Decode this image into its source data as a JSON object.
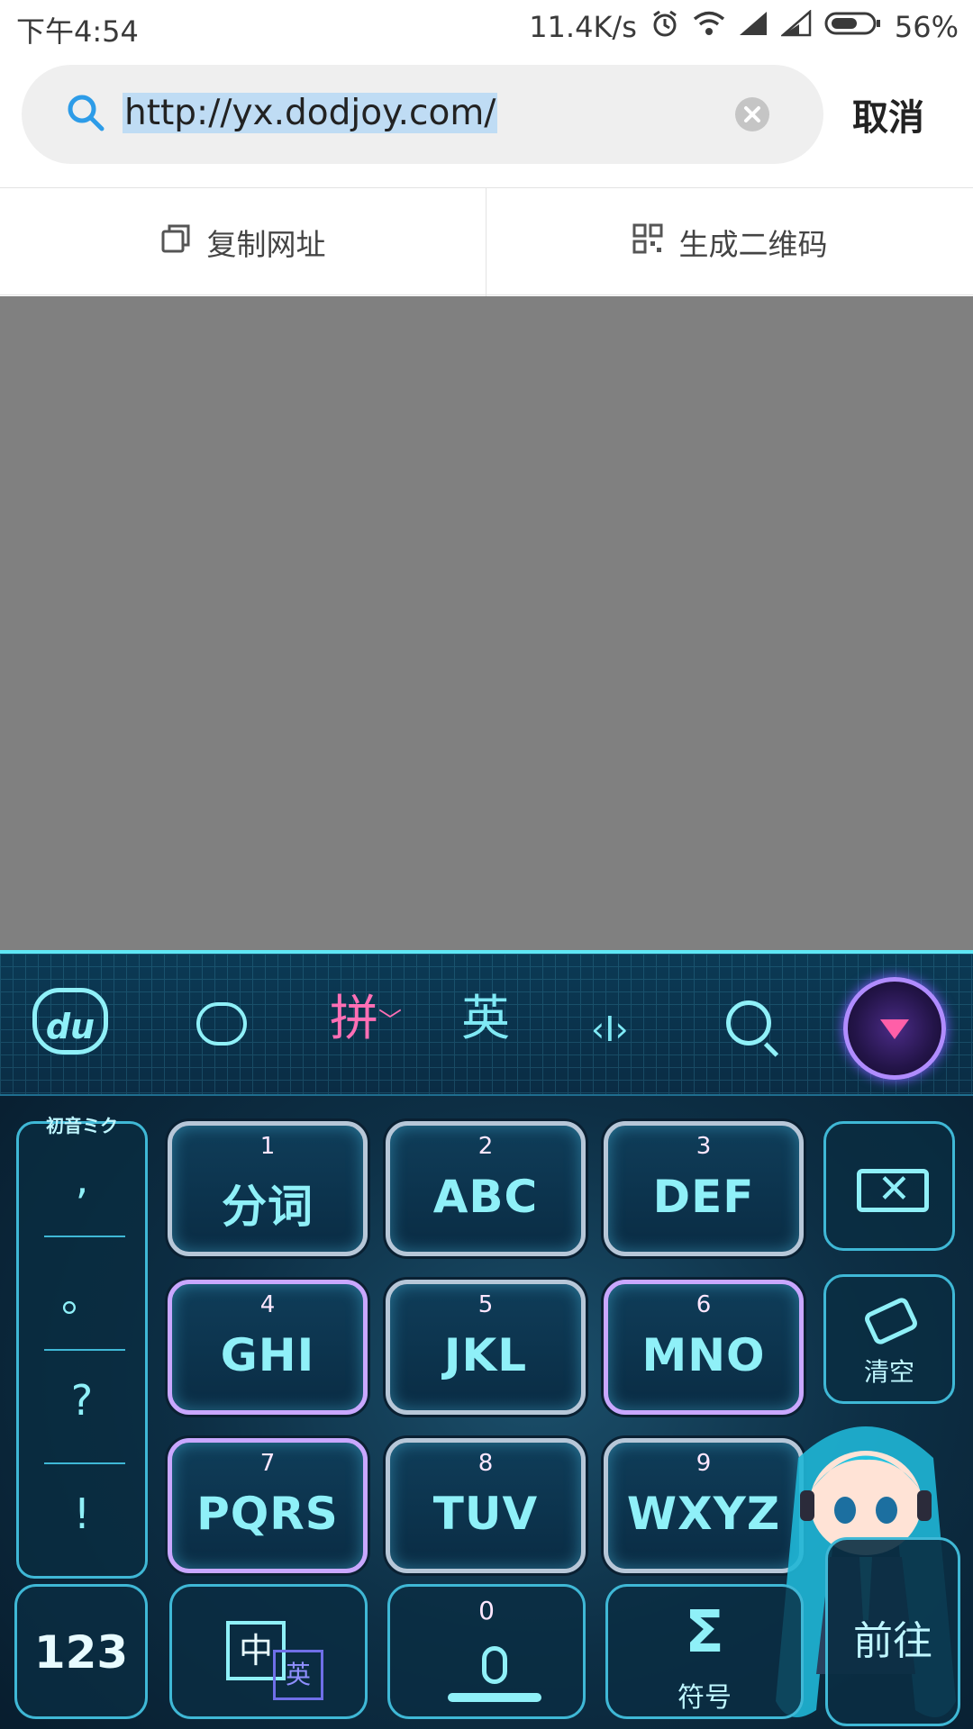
{
  "status_bar": {
    "time": "下午4:54",
    "speed": "11.4K/s",
    "battery": "56%"
  },
  "search": {
    "url": "http://yx.dodjoy.com/",
    "cancel_label": "取消"
  },
  "actions": {
    "copy_label": "复制网址",
    "qr_label": "生成二维码"
  },
  "keyboard": {
    "toolbar": {
      "logo": "du",
      "pinyin": "拼",
      "english": "英",
      "cursor": "‹I›"
    },
    "punc_title": "初音ミク",
    "punctuation": [
      ",",
      "。",
      "?",
      "!"
    ],
    "keys": [
      {
        "num": "1",
        "label": "分词"
      },
      {
        "num": "2",
        "label": "ABC"
      },
      {
        "num": "3",
        "label": "DEF"
      },
      {
        "num": "4",
        "label": "GHI"
      },
      {
        "num": "5",
        "label": "JKL"
      },
      {
        "num": "6",
        "label": "MNO"
      },
      {
        "num": "7",
        "label": "PQRS"
      },
      {
        "num": "8",
        "label": "TUV"
      },
      {
        "num": "9",
        "label": "WXYZ"
      }
    ],
    "clear_label": "清空",
    "num_key": "123",
    "zh_label": "中",
    "en_label": "英",
    "zero": "0",
    "sigma": "Σ",
    "symbol_label": "符号",
    "go_label": "前往"
  }
}
